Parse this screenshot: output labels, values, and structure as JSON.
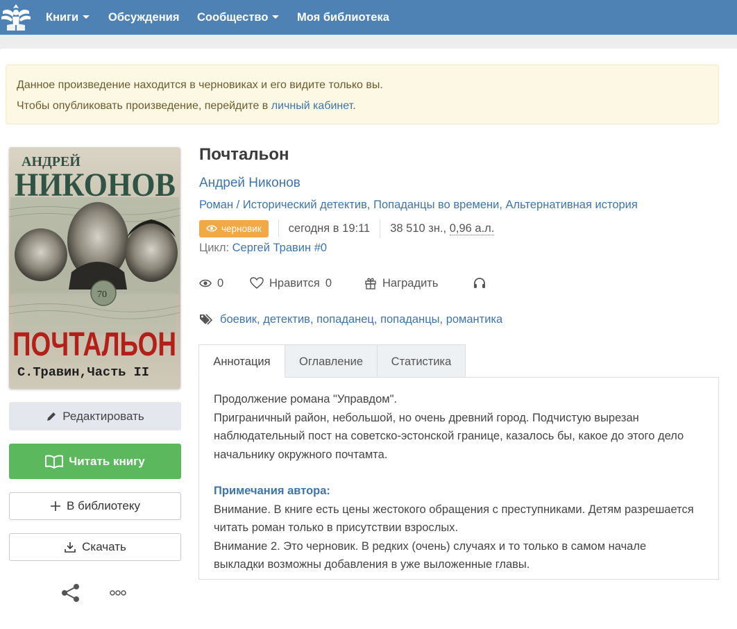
{
  "nav": {
    "items": [
      {
        "label": "Книги",
        "dropdown": true
      },
      {
        "label": "Обсуждения",
        "dropdown": false
      },
      {
        "label": "Сообщество",
        "dropdown": true
      },
      {
        "label": "Моя библиотека",
        "dropdown": false
      }
    ]
  },
  "alert": {
    "line1": "Данное произведение находится в черновиках и его видите только вы.",
    "line2_before": "Чтобы опубликовать произведение, перейдите в ",
    "line2_link": "личный кабинет",
    "line2_after": "."
  },
  "cover": {
    "author_top": "АНДРЕЙ",
    "author_name": "НИКОНОВ",
    "title": "ПОЧТАЛЬОН",
    "subtitle": "С.Травин,Часть II",
    "stamp_value": "70"
  },
  "actions": {
    "edit": "Редактировать",
    "read": "Читать книгу",
    "library": "В библиотеку",
    "download": "Скачать"
  },
  "book": {
    "title": "Почтальон",
    "author": "Андрей Никонов",
    "form": "Роман",
    "genres": [
      "Исторический детектив",
      "Попаданцы во времени",
      "Альтернативная история"
    ],
    "status_badge": "черновик",
    "updated": "сегодня в 19:11",
    "size": "38 510 зн., ",
    "size_al": "0,96 а.л.",
    "cycle_label": "Цикл: ",
    "cycle": "Сергей Травин #0"
  },
  "stats": {
    "views": "0",
    "likes_label": "Нравится",
    "likes": "0",
    "reward_label": "Наградить"
  },
  "tags": [
    "боевик",
    "детектив",
    "попаданец",
    "попаданцы",
    "романтика"
  ],
  "tabs": [
    "Аннотация",
    "Оглавление",
    "Статистика"
  ],
  "annotation": {
    "p1": "Продолжение романа \"Управдом\".",
    "p2": "Приграничный район, небольшой, но очень древний город. Подчистую вырезан наблюдательный пост на советско-эстонской границе, казалось бы, какое до этого дело начальнику окружного почтамта.",
    "note_title": "Примечания автора:",
    "note1": "Внимание. В книге есть цены жестокого обращения с преступниками. Детям разрешается читать роман только в присутствии взрослых.",
    "note2": "Внимание 2. Это черновик. В редких (очень) случаях и то только в самом начале выкладки возможны добавления в уже выложенные главы."
  },
  "colors": {
    "nav_bg": "#4f82b4",
    "link": "#3c75ad",
    "read_button": "#5bb85d",
    "draft_badge": "#f0a944",
    "alert_bg": "#fcf8e4"
  }
}
